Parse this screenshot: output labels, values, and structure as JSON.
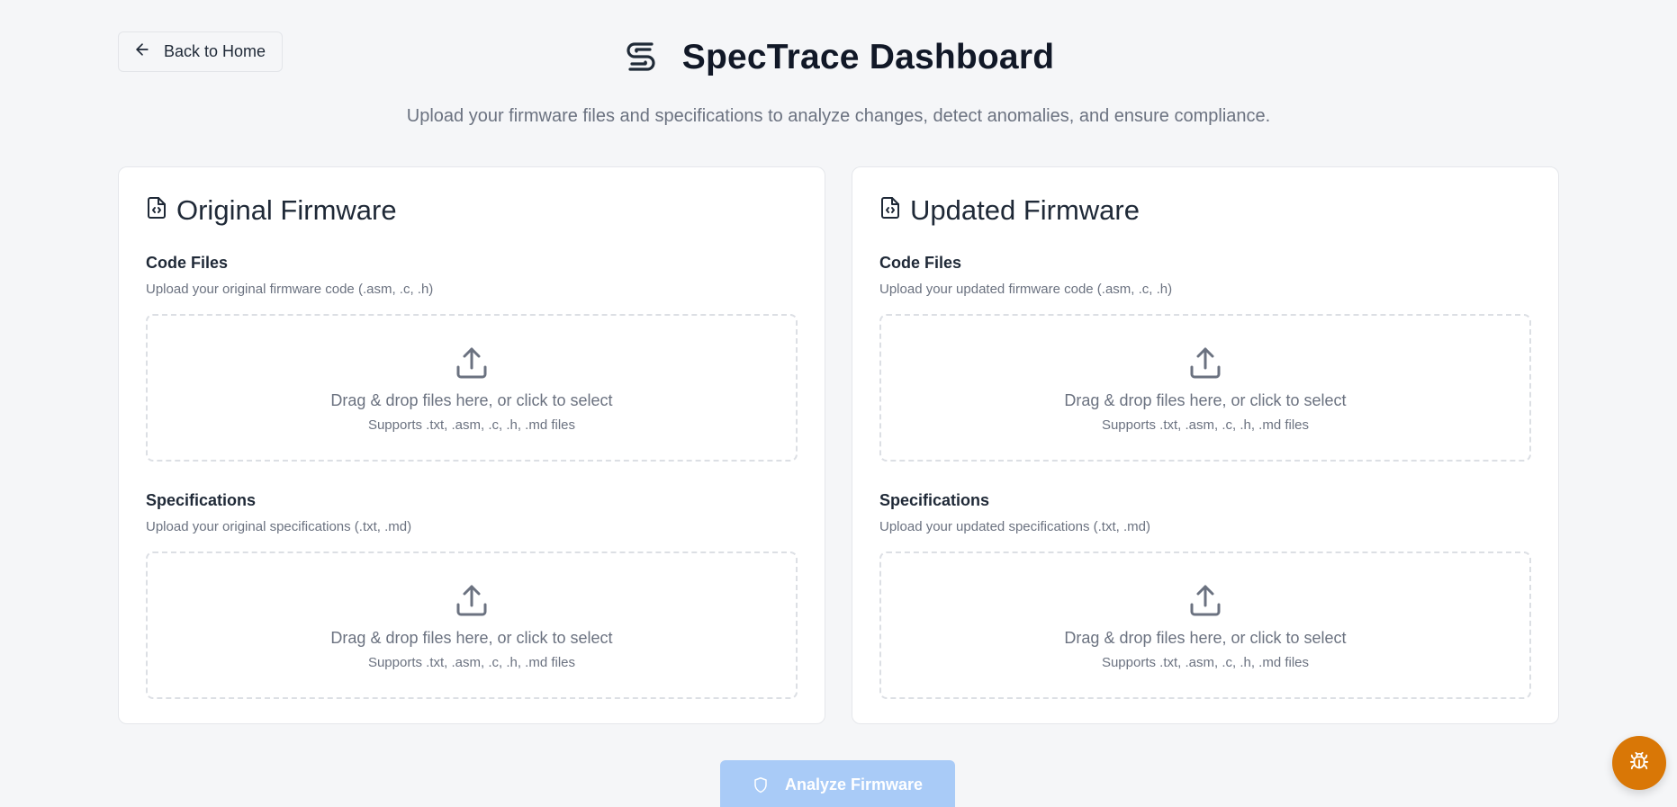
{
  "nav": {
    "back_label": "Back to Home"
  },
  "header": {
    "title": "SpecTrace Dashboard",
    "subtitle": "Upload your firmware files and specifications to analyze changes, detect anomalies, and ensure compliance."
  },
  "cards": [
    {
      "title": "Original Firmware",
      "code": {
        "label": "Code Files",
        "hint": "Upload your original firmware code (.asm, .c, .h)",
        "drop_text": "Drag & drop files here, or click to select",
        "drop_sub": "Supports .txt, .asm, .c, .h, .md files"
      },
      "specs": {
        "label": "Specifications",
        "hint": "Upload your original specifications (.txt, .md)",
        "drop_text": "Drag & drop files here, or click to select",
        "drop_sub": "Supports .txt, .asm, .c, .h, .md files"
      }
    },
    {
      "title": "Updated Firmware",
      "code": {
        "label": "Code Files",
        "hint": "Upload your updated firmware code (.asm, .c, .h)",
        "drop_text": "Drag & drop files here, or click to select",
        "drop_sub": "Supports .txt, .asm, .c, .h, .md files"
      },
      "specs": {
        "label": "Specifications",
        "hint": "Upload your updated specifications (.txt, .md)",
        "drop_text": "Drag & drop files here, or click to select",
        "drop_sub": "Supports .txt, .asm, .c, .h, .md files"
      }
    }
  ],
  "actions": {
    "analyze_label": "Analyze Firmware"
  },
  "icons": {
    "back": "arrow-left-icon",
    "logo": "spectrace-logo",
    "card": "file-code-icon",
    "upload": "upload-icon",
    "analyze": "shield-icon",
    "fab": "bug-icon"
  },
  "colors": {
    "background": "#f5f6f8",
    "analyze_button": "#a9cbf7",
    "fab": "#d97706",
    "text_muted": "#6b7280"
  }
}
